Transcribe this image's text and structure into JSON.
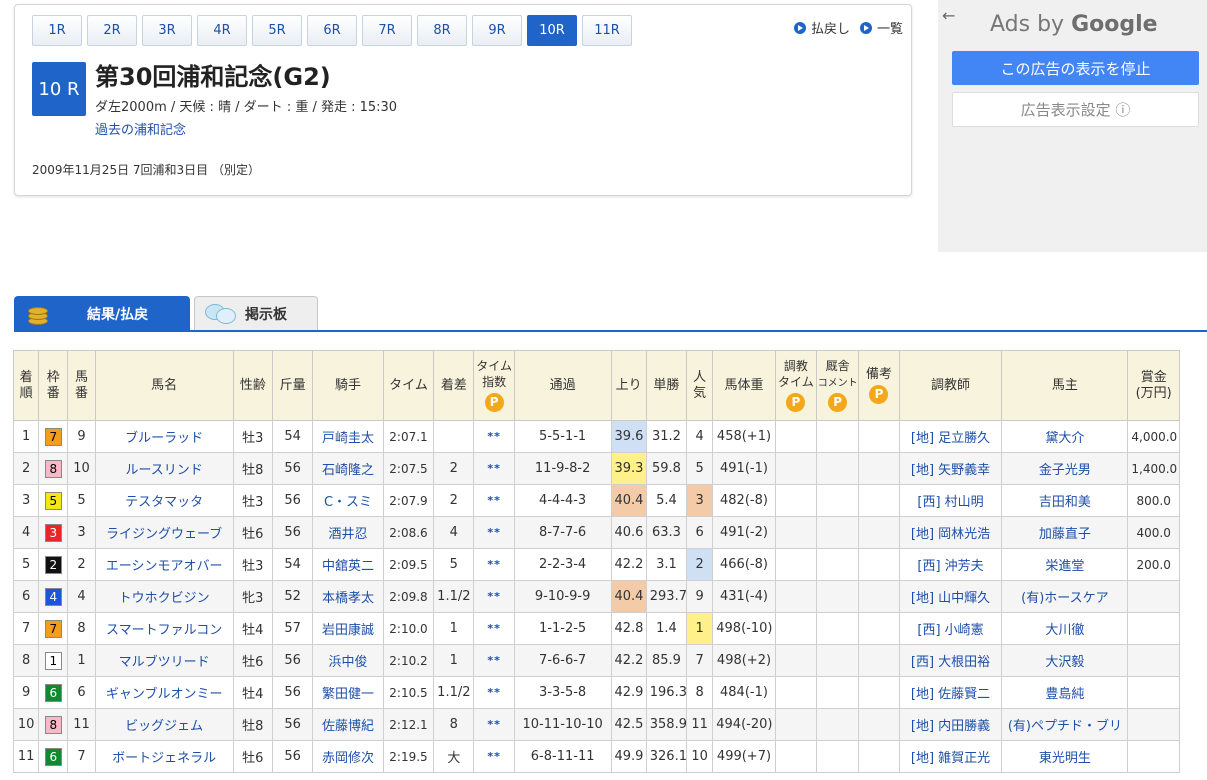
{
  "race_nav": [
    "1R",
    "2R",
    "3R",
    "4R",
    "5R",
    "6R",
    "7R",
    "8R",
    "9R",
    "10R",
    "11R"
  ],
  "race_nav_active": 9,
  "top_links": {
    "payout": "払戻し",
    "list": "一覧"
  },
  "race": {
    "number": "10 R",
    "title": "第30回浦和記念(G2)",
    "info": "ダ左2000m / 天候 : 晴 / ダート : 重 / 発走 : 15:30",
    "past_link": "過去の浦和記念",
    "date": "2009年11月25日 7回浦和3日目 （別定）"
  },
  "ads": {
    "back": "←",
    "title_prefix": "Ads by ",
    "title_brand": "Google",
    "stop": "この広告の表示を停止",
    "settings": "広告表示設定 ⓘ"
  },
  "tabs": {
    "result": "結果/払戻",
    "board": "掲示板"
  },
  "headers": {
    "rank": [
      "着",
      "順"
    ],
    "waku": [
      "枠",
      "番"
    ],
    "umaban": [
      "馬",
      "番"
    ],
    "name": "馬名",
    "sexage": "性齢",
    "weight": "斤量",
    "jockey": "騎手",
    "time": "タイム",
    "margin": "着差",
    "time_index": [
      "タイム",
      "指数"
    ],
    "passing": "通過",
    "last3f": "上り",
    "odds": "単勝",
    "pop": [
      "人",
      "気"
    ],
    "body": "馬体重",
    "train_time": [
      "調教",
      "タイム"
    ],
    "stable": [
      "厩舎",
      "コメント"
    ],
    "note": "備考",
    "trainer": "調教師",
    "owner": "馬主",
    "prize": [
      "賞金",
      "(万円)"
    ]
  },
  "colors": {
    "waku": {
      "1": {
        "bg": "#ffffff",
        "fg": "#000000"
      },
      "2": {
        "bg": "#111111",
        "fg": "#ffffff"
      },
      "3": {
        "bg": "#e8262a",
        "fg": "#ffffff"
      },
      "4": {
        "bg": "#1a56d6",
        "fg": "#ffffff"
      },
      "5": {
        "bg": "#f6e712",
        "fg": "#000000"
      },
      "6": {
        "bg": "#0f8a2e",
        "fg": "#ffffff"
      },
      "7": {
        "bg": "#f39c1e",
        "fg": "#000000"
      },
      "8": {
        "bg": "#f7b8c8",
        "fg": "#000000"
      }
    },
    "hl": {
      "blue": "#cfe0f5",
      "yellow": "#fff08a",
      "orange": "#f3cba8"
    }
  },
  "rows": [
    {
      "rank": "1",
      "waku": "7",
      "umaban": "9",
      "name": "ブルーラッド",
      "sexage": "牡3",
      "weight": "54",
      "jockey": "戸崎圭太",
      "time": "2:07.1",
      "margin": "",
      "ti": "**",
      "passing": "5-5-1-1",
      "last3f": "39.6",
      "last3f_hl": "blue",
      "odds": "31.2",
      "pop": "4",
      "pop_hl": "",
      "body": "458(+1)",
      "trainer": "[地] 足立勝久",
      "owner": "黛大介",
      "prize": "4,000.0"
    },
    {
      "rank": "2",
      "waku": "8",
      "umaban": "10",
      "name": "ルースリンド",
      "sexage": "牡8",
      "weight": "56",
      "jockey": "石崎隆之",
      "time": "2:07.5",
      "margin": "2",
      "ti": "**",
      "passing": "11-9-8-2",
      "last3f": "39.3",
      "last3f_hl": "yellow",
      "odds": "59.8",
      "pop": "5",
      "pop_hl": "",
      "body": "491(-1)",
      "trainer": "[地] 矢野義幸",
      "owner": "金子光男",
      "prize": "1,400.0"
    },
    {
      "rank": "3",
      "waku": "5",
      "umaban": "5",
      "name": "テスタマッタ",
      "sexage": "牡3",
      "weight": "56",
      "jockey": "C・スミ",
      "time": "2:07.9",
      "margin": "2",
      "ti": "**",
      "passing": "4-4-4-3",
      "last3f": "40.4",
      "last3f_hl": "orange",
      "odds": "5.4",
      "pop": "3",
      "pop_hl": "orange",
      "body": "482(-8)",
      "trainer": "[西] 村山明",
      "owner": "吉田和美",
      "prize": "800.0"
    },
    {
      "rank": "4",
      "waku": "3",
      "umaban": "3",
      "name": "ライジングウェーブ",
      "sexage": "牡6",
      "weight": "56",
      "jockey": "酒井忍",
      "time": "2:08.6",
      "margin": "4",
      "ti": "**",
      "passing": "8-7-7-6",
      "last3f": "40.6",
      "last3f_hl": "",
      "odds": "63.3",
      "pop": "6",
      "pop_hl": "",
      "body": "491(-2)",
      "trainer": "[地] 岡林光浩",
      "owner": "加藤直子",
      "prize": "400.0"
    },
    {
      "rank": "5",
      "waku": "2",
      "umaban": "2",
      "name": "エーシンモアオバー",
      "sexage": "牡3",
      "weight": "54",
      "jockey": "中舘英二",
      "time": "2:09.5",
      "margin": "5",
      "ti": "**",
      "passing": "2-2-3-4",
      "last3f": "42.2",
      "last3f_hl": "",
      "odds": "3.1",
      "pop": "2",
      "pop_hl": "blue",
      "body": "466(-8)",
      "trainer": "[西] 沖芳夫",
      "owner": "栄進堂",
      "prize": "200.0"
    },
    {
      "rank": "6",
      "waku": "4",
      "umaban": "4",
      "name": "トウホクビジン",
      "sexage": "牝3",
      "weight": "52",
      "jockey": "本橋孝太",
      "time": "2:09.8",
      "margin": "1.1/2",
      "ti": "**",
      "passing": "9-10-9-9",
      "last3f": "40.4",
      "last3f_hl": "orange",
      "odds": "293.7",
      "pop": "9",
      "pop_hl": "",
      "body": "431(-4)",
      "trainer": "[地] 山中輝久",
      "owner": "(有)ホースケア",
      "prize": ""
    },
    {
      "rank": "7",
      "waku": "7",
      "umaban": "8",
      "name": "スマートファルコン",
      "sexage": "牡4",
      "weight": "57",
      "jockey": "岩田康誠",
      "time": "2:10.0",
      "margin": "1",
      "ti": "**",
      "passing": "1-1-2-5",
      "last3f": "42.8",
      "last3f_hl": "",
      "odds": "1.4",
      "pop": "1",
      "pop_hl": "yellow",
      "body": "498(-10)",
      "trainer": "[西] 小崎憲",
      "owner": "大川徹",
      "prize": ""
    },
    {
      "rank": "8",
      "waku": "1",
      "umaban": "1",
      "name": "マルブツリード",
      "sexage": "牡6",
      "weight": "56",
      "jockey": "浜中俊",
      "time": "2:10.2",
      "margin": "1",
      "ti": "**",
      "passing": "7-6-6-7",
      "last3f": "42.2",
      "last3f_hl": "",
      "odds": "85.9",
      "pop": "7",
      "pop_hl": "",
      "body": "498(+2)",
      "trainer": "[西] 大根田裕",
      "owner": "大沢毅",
      "prize": ""
    },
    {
      "rank": "9",
      "waku": "6",
      "umaban": "6",
      "name": "ギャンブルオンミー",
      "sexage": "牡4",
      "weight": "56",
      "jockey": "繁田健一",
      "time": "2:10.5",
      "margin": "1.1/2",
      "ti": "**",
      "passing": "3-3-5-8",
      "last3f": "42.9",
      "last3f_hl": "",
      "odds": "196.3",
      "pop": "8",
      "pop_hl": "",
      "body": "484(-1)",
      "trainer": "[地] 佐藤賢二",
      "owner": "豊島純",
      "prize": ""
    },
    {
      "rank": "10",
      "waku": "8",
      "umaban": "11",
      "name": "ビッグジェム",
      "sexage": "牡8",
      "weight": "56",
      "jockey": "佐藤博紀",
      "time": "2:12.1",
      "margin": "8",
      "ti": "**",
      "passing": "10-11-10-10",
      "last3f": "42.5",
      "last3f_hl": "",
      "odds": "358.9",
      "pop": "11",
      "pop_hl": "",
      "body": "494(-20)",
      "trainer": "[地] 内田勝義",
      "owner": "(有)ペプチド・ブリ",
      "prize": ""
    },
    {
      "rank": "11",
      "waku": "6",
      "umaban": "7",
      "name": "ボートジェネラル",
      "sexage": "牡6",
      "weight": "56",
      "jockey": "赤岡修次",
      "time": "2:19.5",
      "margin": "大",
      "ti": "**",
      "passing": "6-8-11-11",
      "last3f": "49.9",
      "last3f_hl": "",
      "odds": "326.1",
      "pop": "10",
      "pop_hl": "",
      "body": "499(+7)",
      "trainer": "[地] 雑賀正光",
      "owner": "東光明生",
      "prize": ""
    }
  ]
}
